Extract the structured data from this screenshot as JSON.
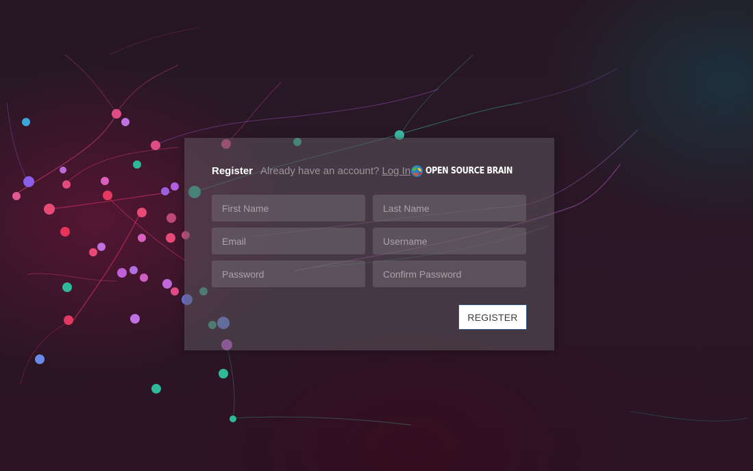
{
  "card": {
    "title": "Register",
    "subtext": "Already have an account?",
    "login_link": "Log In",
    "logo_text": "OPEN SOURCE BRAIN",
    "logo_icon": "brain-globe-icon"
  },
  "form": {
    "first_name": {
      "placeholder": "First Name",
      "value": ""
    },
    "last_name": {
      "placeholder": "Last Name",
      "value": ""
    },
    "email": {
      "placeholder": "Email",
      "value": ""
    },
    "username": {
      "placeholder": "Username",
      "value": ""
    },
    "password": {
      "placeholder": "Password",
      "value": ""
    },
    "confirm_password": {
      "placeholder": "Confirm Password",
      "value": ""
    }
  },
  "actions": {
    "register_label": "REGISTER"
  },
  "colors": {
    "card_background": "#5c565c",
    "button_background": "#ffffff",
    "button_border": "#2d5a86",
    "text_primary": "#ffffff",
    "text_muted": "#9b9498"
  }
}
